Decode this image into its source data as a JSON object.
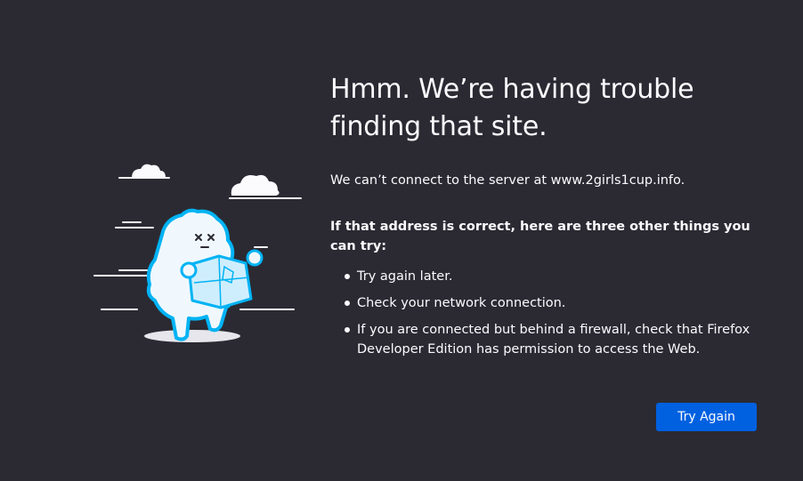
{
  "error": {
    "title": "Hmm. We’re having trouble finding that site.",
    "short_description": "We can’t connect to the server at www.2girls1cup.info.",
    "advice_heading": "If that address is correct, here are three other things you can try:",
    "advice_items": [
      "Try again later.",
      "Check your network connection.",
      "If you are connected but behind a firewall, check that Firefox Developer Edition has permission to access the Web."
    ],
    "try_again_label": "Try Again"
  },
  "colors": {
    "background": "#2b2a33",
    "text": "#fbfbfe",
    "primary_button": "#0061e0",
    "illustration_accent": "#00b3f4"
  },
  "icons": {
    "illustration": "lost-map-mascot-illustration"
  }
}
